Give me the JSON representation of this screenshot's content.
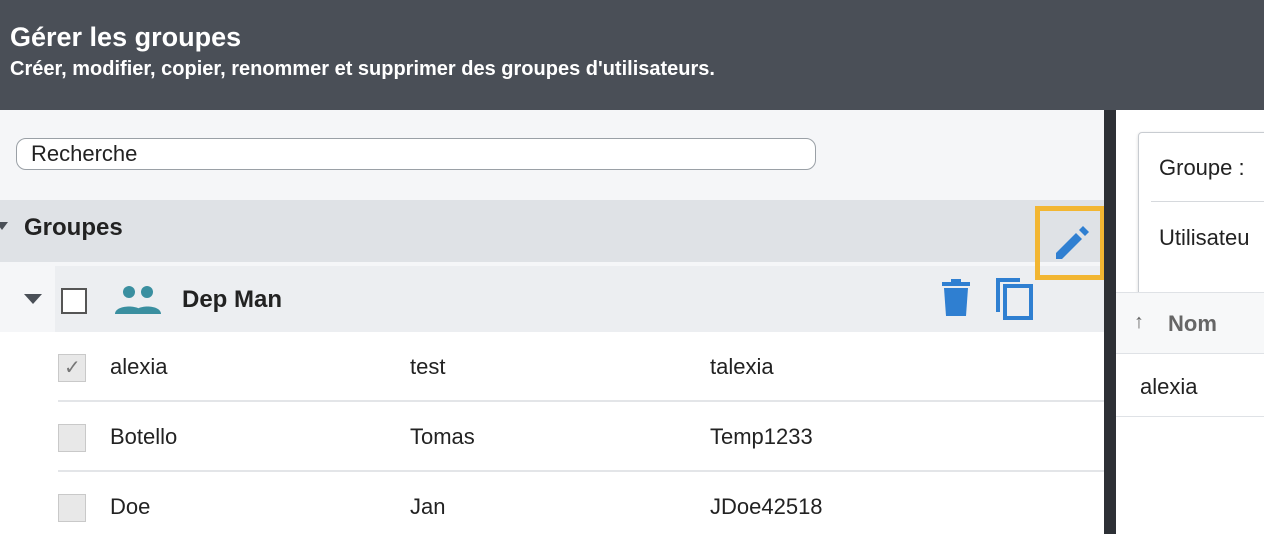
{
  "header": {
    "title": "Gérer les groupes",
    "subtitle": "Créer, modifier, copier, renommer et supprimer des groupes d'utilisateurs."
  },
  "search": {
    "placeholder": "Recherche"
  },
  "tree": {
    "root_label": "Groupes",
    "group": {
      "name": "Dep Man",
      "icon": "users-icon",
      "actions": [
        "trash-icon",
        "copy-icon",
        "edit-icon"
      ],
      "accent_color": "#2f7fd1",
      "icon_color": "#3a8fa0"
    },
    "users": [
      {
        "last": "alexia",
        "first": "test",
        "login": "talexia",
        "checked": true
      },
      {
        "last": "Botello",
        "first": "Tomas",
        "login": "Temp1233",
        "checked": false
      },
      {
        "last": "Doe",
        "first": "Jan",
        "login": "JDoe42518",
        "checked": false
      }
    ]
  },
  "detail": {
    "group_label": "Groupe :",
    "users_label": "Utilisateu",
    "column_header": "Nom",
    "sort_icon": "arrow-up-icon",
    "first_value": "alexia"
  },
  "highlight_color": "#f2b632"
}
